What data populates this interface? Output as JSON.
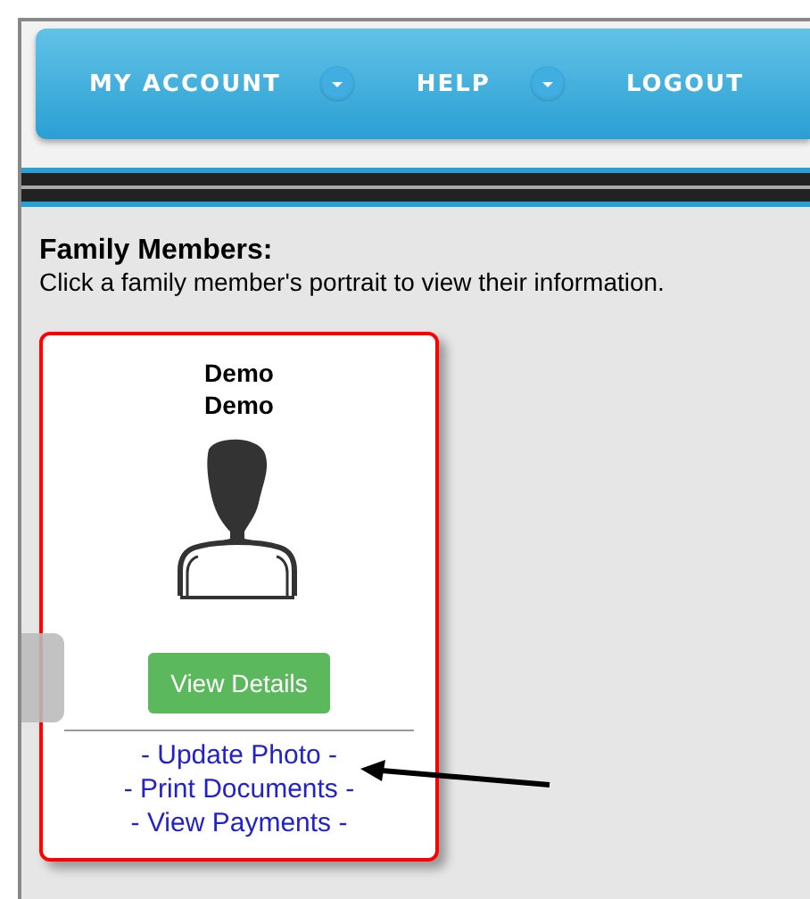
{
  "nav": {
    "items": [
      {
        "label": "MY ACCOUNT",
        "dropdown": true
      },
      {
        "label": "HELP",
        "dropdown": true
      },
      {
        "label": "LOGOUT",
        "dropdown": false
      }
    ]
  },
  "section": {
    "title": "Family Members:",
    "instructions": "Click a family member's portrait to view their information."
  },
  "members": [
    {
      "first_name": "Demo",
      "last_name": "Demo",
      "highlighted": true,
      "button": "View Details",
      "links": [
        "- Update Photo -",
        "- Print Documents -",
        "- View Payments -"
      ]
    }
  ]
}
